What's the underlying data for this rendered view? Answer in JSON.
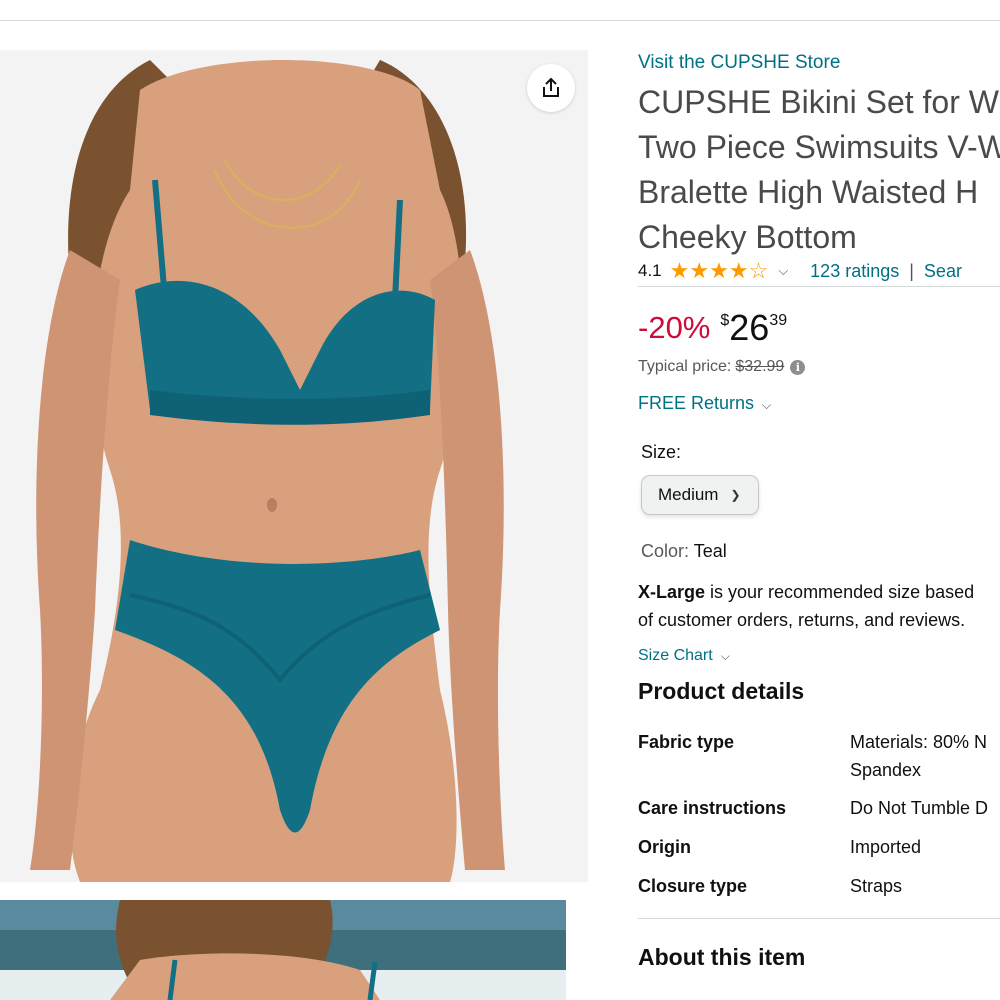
{
  "gallery": {
    "main_image_alt": "",
    "share_icon": "share-icon"
  },
  "store": {
    "link_text": "Visit the CUPSHE Store"
  },
  "product": {
    "title_lines": [
      "CUPSHE Bikini Set for W",
      "Two Piece Swimsuits V-W",
      "Bralette High Waisted H",
      "Cheeky Bottom"
    ]
  },
  "rating": {
    "value": "4.1",
    "stars": 4,
    "count_text": "123 ratings",
    "separator": "|",
    "search_text": "Sear"
  },
  "price": {
    "discount": "-20%",
    "currency": "$",
    "whole": "26",
    "fraction": "39",
    "typical_label": "Typical price:",
    "typical_value": "$32.99"
  },
  "returns": {
    "text": "FREE Returns"
  },
  "size": {
    "label": "Size:",
    "selected": "Medium"
  },
  "color": {
    "label": "Color:",
    "value": "Teal"
  },
  "recommendation": {
    "size": "X-Large",
    "line1_rest": " is your recommended size based",
    "line2": "of customer orders, returns, and reviews."
  },
  "size_chart": {
    "text": "Size Chart"
  },
  "product_details": {
    "heading": "Product details",
    "rows": [
      {
        "key": "Fabric type",
        "value": "Materials: 80% N Spandex"
      },
      {
        "key": "Care instructions",
        "value": "Do Not Tumble D"
      },
      {
        "key": "Origin",
        "value": "Imported"
      },
      {
        "key": "Closure type",
        "value": "Straps"
      }
    ]
  },
  "about": {
    "heading": "About this item"
  },
  "colors": {
    "accent_link": "#007185",
    "discount": "#cc0c39",
    "star": "#ff9900",
    "swim_teal": "#136f84"
  }
}
